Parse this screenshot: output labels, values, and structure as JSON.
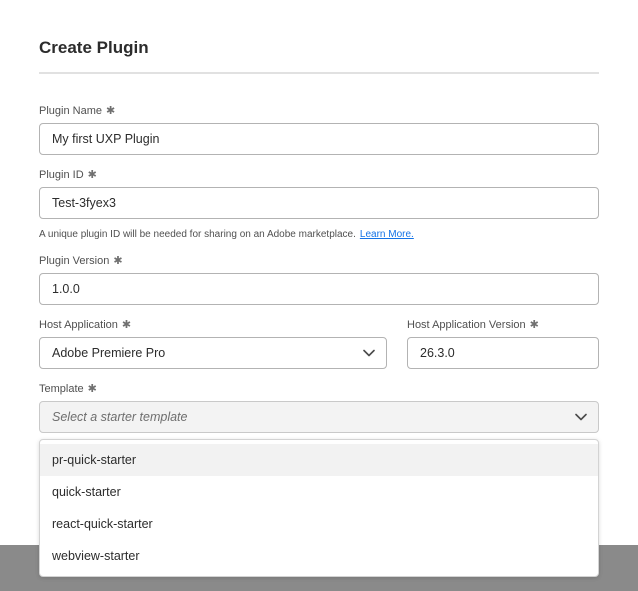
{
  "dialog": {
    "title": "Create Plugin",
    "required_mark": "✱"
  },
  "plugin_name": {
    "label": "Plugin Name",
    "value": "My first UXP Plugin"
  },
  "plugin_id": {
    "label": "Plugin ID",
    "value": "Test-3fyex3",
    "help_text": "A unique plugin ID will be needed for sharing on an Adobe marketplace.",
    "learn_more": "Learn More."
  },
  "plugin_version": {
    "label": "Plugin Version",
    "value": "1.0.0"
  },
  "host_application": {
    "label": "Host Application",
    "value": "Adobe Premiere Pro"
  },
  "host_application_version": {
    "label": "Host Application Version",
    "value": "26.3.0"
  },
  "template": {
    "label": "Template",
    "placeholder": "Select a starter template",
    "options": [
      "pr-quick-starter",
      "quick-starter",
      "react-quick-starter",
      "webview-starter"
    ]
  },
  "icons": {
    "chevron": "chevron-down-icon",
    "required": "asterisk-icon"
  },
  "colors": {
    "link": "#1473e6",
    "backdrop": "#8a8a8a",
    "hover_option": "#f2f2f2"
  }
}
